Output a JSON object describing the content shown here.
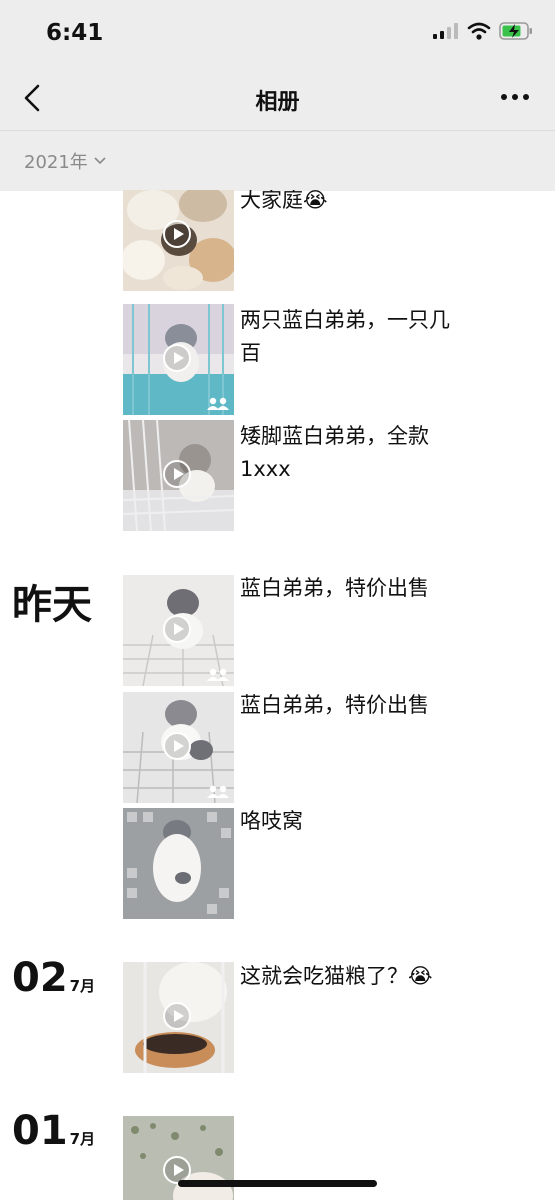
{
  "status": {
    "time": "6:41"
  },
  "nav": {
    "title": "相册",
    "back_icon": "chevron-left-icon",
    "more_icon": "more-icon"
  },
  "filter": {
    "year": "2021年"
  },
  "sections": [
    {
      "date": "",
      "items": [
        {
          "caption": "大家庭😭",
          "video": true,
          "group": false
        },
        {
          "caption": "两只蓝白弟弟，一只几百",
          "video": true,
          "group": true
        },
        {
          "caption": "矮脚蓝白弟弟，全款1xxx",
          "video": true,
          "group": false
        }
      ]
    },
    {
      "date": "昨天",
      "items": [
        {
          "caption": "蓝白弟弟，特价出售",
          "video": true,
          "group": true
        },
        {
          "caption": "蓝白弟弟，特价出售",
          "video": true,
          "group": true
        },
        {
          "caption": "咯吱窝",
          "video": false,
          "group": false
        }
      ]
    },
    {
      "day": "02",
      "month": "7月",
      "items": [
        {
          "caption": "这就会吃猫粮了？😭",
          "video": true,
          "group": false
        }
      ]
    },
    {
      "day": "01",
      "month": "7月",
      "items": [
        {
          "caption": "",
          "video": true,
          "group": false
        }
      ]
    }
  ]
}
